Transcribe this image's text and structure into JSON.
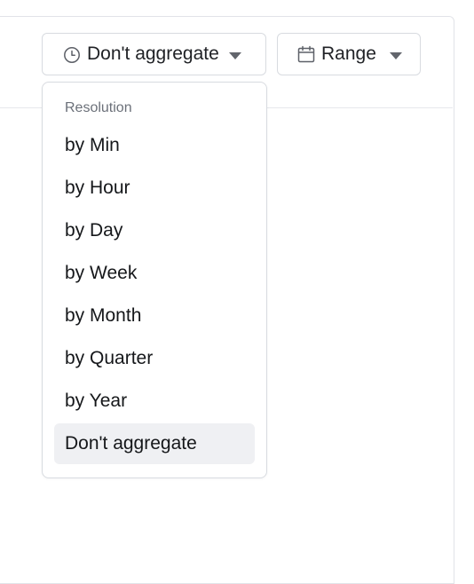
{
  "toolbar": {
    "aggregate_button": {
      "label": "Don't aggregate",
      "icon": "clock-icon",
      "caret": "caret-down-icon"
    },
    "range_button": {
      "label": "Range",
      "icon": "calendar-icon",
      "caret": "caret-down-icon"
    }
  },
  "dropdown": {
    "header": "Resolution",
    "items": [
      {
        "label": "by Min"
      },
      {
        "label": "by Hour"
      },
      {
        "label": "by Day"
      },
      {
        "label": "by Week"
      },
      {
        "label": "by Month"
      },
      {
        "label": "by Quarter"
      },
      {
        "label": "by Year"
      },
      {
        "label": "Don't aggregate",
        "selected": true
      }
    ]
  },
  "colors": {
    "selected_item_bg": "#eff0f3",
    "border": "#d8dbe0",
    "muted_text": "#6b7079"
  }
}
